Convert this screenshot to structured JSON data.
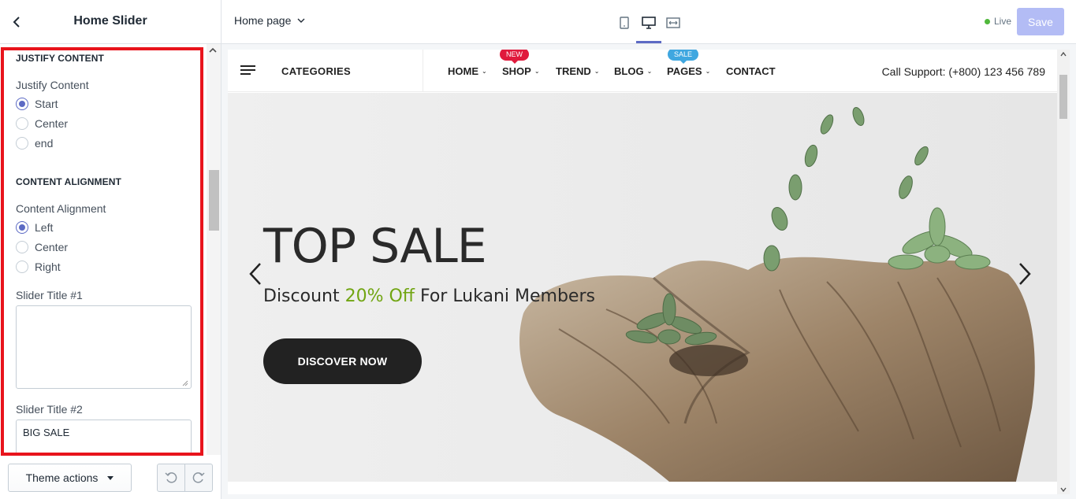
{
  "sidebar": {
    "title": "Home Slider",
    "justify_content": {
      "heading": "JUSTIFY CONTENT",
      "label": "Justify Content",
      "options": [
        "Start",
        "Center",
        "end"
      ],
      "selected": "Start"
    },
    "content_alignment": {
      "heading": "CONTENT ALIGNMENT",
      "label": "Content Alignment",
      "options": [
        "Left",
        "Center",
        "Right"
      ],
      "selected": "Left"
    },
    "slider_title_1": {
      "label": "Slider Title #1",
      "value": ""
    },
    "slider_title_2": {
      "label": "Slider Title #2",
      "value": "BIG SALE"
    },
    "footer": {
      "theme_actions": "Theme actions"
    }
  },
  "topbar": {
    "page": "Home page",
    "live": "Live",
    "save": "Save",
    "active_device": "desktop"
  },
  "preview": {
    "nav": {
      "categories": "CATEGORIES",
      "items": [
        {
          "label": "HOME",
          "badge": ""
        },
        {
          "label": "SHOP",
          "badge": "NEW"
        },
        {
          "label": "TREND",
          "badge": ""
        },
        {
          "label": "BLOG",
          "badge": ""
        },
        {
          "label": "PAGES",
          "badge": "SALE"
        },
        {
          "label": "CONTACT",
          "badge": ""
        }
      ],
      "support": "Call Support: (+800) 123 456 789"
    },
    "hero": {
      "title": "TOP SALE",
      "subtitle_prefix": "Discount ",
      "subtitle_highlight": "20% Off",
      "subtitle_suffix": " For Lukani Members",
      "button": "DISCOVER NOW"
    }
  },
  "colors": {
    "accent": "#5c6ac4",
    "highlight_outline": "#e8141c",
    "badge_new": "#e01a3c",
    "badge_sale": "#3fa7e0",
    "discount_green": "#71a512",
    "live_dot": "#50b83c"
  }
}
